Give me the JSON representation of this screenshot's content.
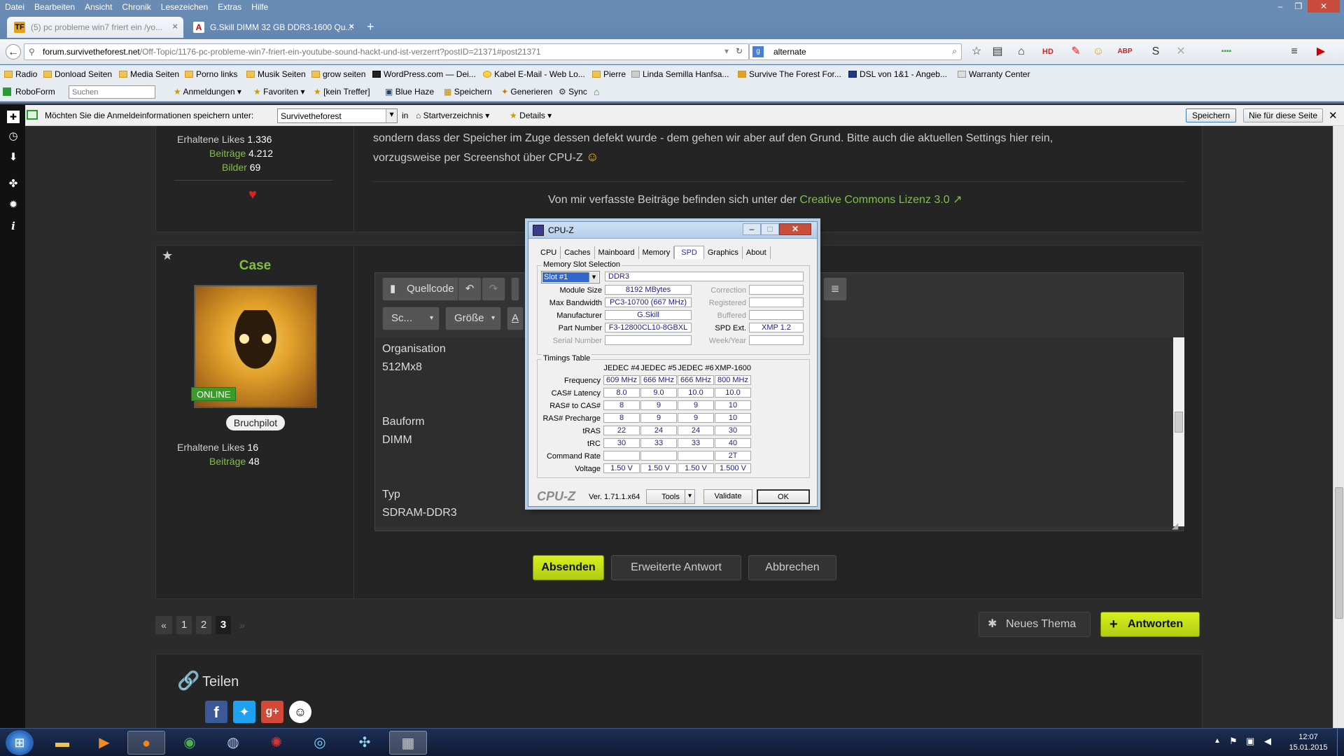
{
  "menu": [
    "Datei",
    "Bearbeiten",
    "Ansicht",
    "Chronik",
    "Lesezeichen",
    "Extras",
    "Hilfe"
  ],
  "tabs": [
    {
      "title": "(5) pc probleme win7 friert ein /yo...",
      "active": true
    },
    {
      "title": "G.Skill DIMM 32 GB DDR3-1600 Qu...",
      "active": false
    }
  ],
  "url": {
    "host": "forum.survivetheforest.net",
    "path": "/Off-Topic/1176-pc-probleme-win7-friert-ein-youtube-sound-hackt-und-ist-verzerrt?postID=21371#post21371"
  },
  "search": {
    "value": "alternate"
  },
  "bookmarks": [
    "Radio",
    "Donload Seiten",
    "Media Seiten",
    "Porno links",
    "Musik Seiten",
    "grow seiten",
    "WordPress.com — Dei...",
    "Kabel E-Mail - Web Lo...",
    "Pierre",
    "Linda Semilla Hanfsa...",
    "Survive The Forest For...",
    "DSL von 1&1 - Angeb...",
    "Warranty Center"
  ],
  "toolbar2": {
    "roboform": "RoboForm",
    "search_placeholder": "Suchen",
    "items": [
      "Anmeldungen",
      "Favoriten",
      "[kein Treffer]",
      "Blue Haze",
      "Speichern",
      "Generieren",
      "Sync"
    ]
  },
  "notif": {
    "text": "Möchten Sie die Anmeldeinformationen speichern unter:",
    "select": "Survivetheforest",
    "in": "in",
    "startdir": "Startverzeichnis",
    "details": "Details",
    "save": "Speichern",
    "never": "Nie für diese Seite"
  },
  "post1": {
    "likes_label": "Erhaltene Likes",
    "likes": "1.336",
    "posts_label": "Beiträge",
    "posts": "4.212",
    "images_label": "Bilder",
    "images": "69",
    "text_line1": "sondern dass der Speicher im Zuge dessen defekt wurde - dem gehen wir aber auf den Grund. Bitte auch die aktuellen Settings hier rein,",
    "text_line2": "vorzugsweise per Screenshot über CPU-Z",
    "sig_prefix": "Von mir verfasste Beiträge befinden sich unter der",
    "sig_link": "Creative Commons Lizenz 3.0"
  },
  "post2": {
    "username": "Case",
    "online": "ONLINE",
    "rank": "Bruchpilot",
    "likes_label": "Erhaltene Likes",
    "likes": "16",
    "posts_label": "Beiträge",
    "posts": "48",
    "editor": {
      "source": "Quellcode",
      "font": "Sc...",
      "size": "Größe"
    },
    "content": [
      {
        "label": "Organisation",
        "value": "512Mx8"
      },
      {
        "label": "Bauform",
        "value": "DIMM"
      },
      {
        "label": "Typ",
        "value": "SDRAM-DDR3"
      }
    ],
    "buttons": {
      "submit": "Absenden",
      "advanced": "Erweiterte Antwort",
      "cancel": "Abbrechen"
    }
  },
  "pagination": [
    "1",
    "2",
    "3"
  ],
  "actions": {
    "new_topic": "Neues Thema",
    "reply": "Antworten"
  },
  "share": {
    "title": "Teilen"
  },
  "cpuz": {
    "title": "CPU-Z",
    "tabs": [
      "CPU",
      "Caches",
      "Mainboard",
      "Memory",
      "SPD",
      "Graphics",
      "About"
    ],
    "active_tab": "SPD",
    "slot_group": "Memory Slot Selection",
    "slot": "Slot #1",
    "type": "DDR3",
    "module_size_label": "Module Size",
    "module_size": "8192 MBytes",
    "max_bw_label": "Max Bandwidth",
    "max_bw": "PC3-10700 (667 MHz)",
    "manufacturer_label": "Manufacturer",
    "manufacturer": "G.Skill",
    "part_label": "Part Number",
    "part": "F3-12800CL10-8GBXL",
    "serial_label": "Serial Number",
    "correction_label": "Correction",
    "registered_label": "Registered",
    "buffered_label": "Buffered",
    "spd_ext_label": "SPD Ext.",
    "spd_ext": "XMP 1.2",
    "week_label": "Week/Year",
    "timings_group": "Timings Table",
    "columns": [
      "JEDEC #4",
      "JEDEC #5",
      "JEDEC #6",
      "XMP-1600"
    ],
    "rows": [
      {
        "label": "Frequency",
        "values": [
          "609 MHz",
          "666 MHz",
          "666 MHz",
          "800 MHz"
        ]
      },
      {
        "label": "CAS# Latency",
        "values": [
          "8.0",
          "9.0",
          "10.0",
          "10.0"
        ]
      },
      {
        "label": "RAS# to CAS#",
        "values": [
          "8",
          "9",
          "9",
          "10"
        ]
      },
      {
        "label": "RAS# Precharge",
        "values": [
          "8",
          "9",
          "9",
          "10"
        ]
      },
      {
        "label": "tRAS",
        "values": [
          "22",
          "24",
          "24",
          "30"
        ]
      },
      {
        "label": "tRC",
        "values": [
          "30",
          "33",
          "33",
          "40"
        ]
      },
      {
        "label": "Command Rate",
        "values": [
          "",
          "",
          "",
          "2T"
        ]
      },
      {
        "label": "Voltage",
        "values": [
          "1.50 V",
          "1.50 V",
          "1.50 V",
          "1.500 V"
        ]
      }
    ],
    "brand": "CPU-Z",
    "version": "Ver. 1.71.1.x64",
    "tools": "Tools",
    "validate": "Validate",
    "ok": "OK"
  },
  "taskbar": {
    "time": "12:07",
    "date": "15.01.2015"
  }
}
